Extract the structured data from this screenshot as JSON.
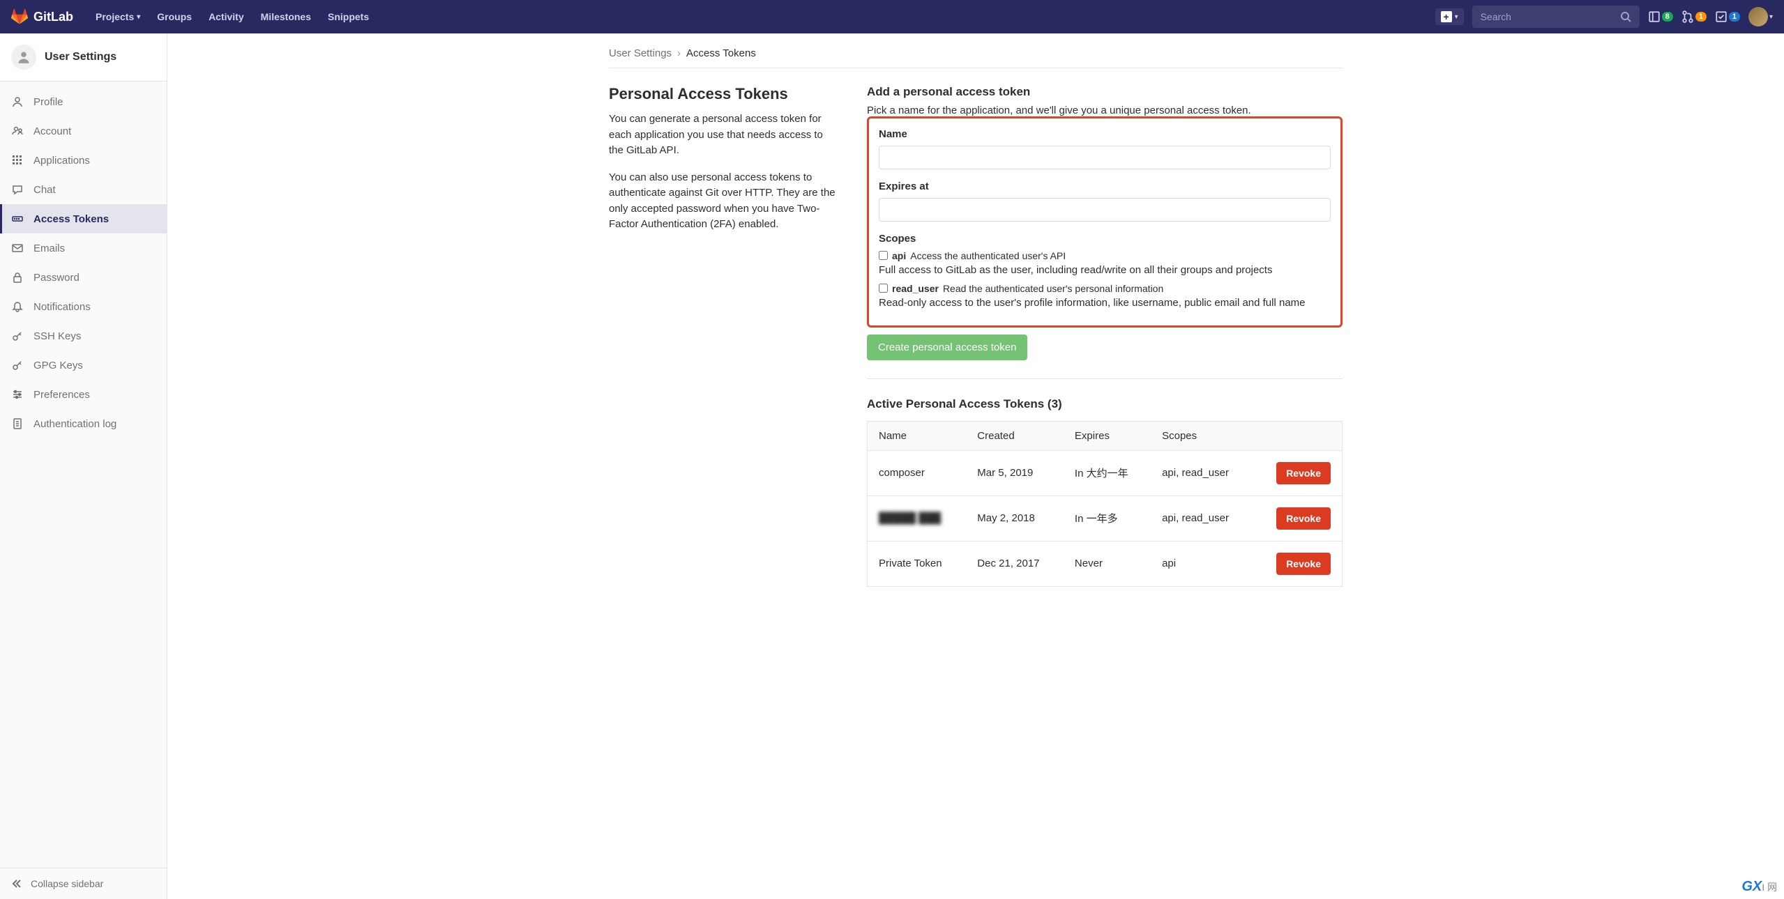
{
  "header": {
    "brand": "GitLab",
    "nav": [
      "Projects",
      "Groups",
      "Activity",
      "Milestones",
      "Snippets"
    ],
    "search_placeholder": "Search",
    "badges": {
      "issues": "8",
      "mrs": "1",
      "todos": "1"
    }
  },
  "sidebar": {
    "title": "User Settings",
    "items": [
      {
        "label": "Profile",
        "icon": "user-icon"
      },
      {
        "label": "Account",
        "icon": "account-icon"
      },
      {
        "label": "Applications",
        "icon": "apps-icon"
      },
      {
        "label": "Chat",
        "icon": "chat-icon"
      },
      {
        "label": "Access Tokens",
        "icon": "token-icon",
        "active": true
      },
      {
        "label": "Emails",
        "icon": "mail-icon"
      },
      {
        "label": "Password",
        "icon": "lock-icon"
      },
      {
        "label": "Notifications",
        "icon": "bell-icon"
      },
      {
        "label": "SSH Keys",
        "icon": "key-icon"
      },
      {
        "label": "GPG Keys",
        "icon": "key-icon"
      },
      {
        "label": "Preferences",
        "icon": "sliders-icon"
      },
      {
        "label": "Authentication log",
        "icon": "log-icon"
      }
    ],
    "collapse_label": "Collapse sidebar"
  },
  "breadcrumb": {
    "parent": "User Settings",
    "current": "Access Tokens"
  },
  "main": {
    "heading": "Personal Access Tokens",
    "desc1": "You can generate a personal access token for each application you use that needs access to the GitLab API.",
    "desc2": "You can also use personal access tokens to authenticate against Git over HTTP. They are the only accepted password when you have Two-Factor Authentication (2FA) enabled.",
    "form_title": "Add a personal access token",
    "form_subtitle": "Pick a name for the application, and we'll give you a unique personal access token.",
    "name_label": "Name",
    "expires_label": "Expires at",
    "scopes_label": "Scopes",
    "scopes": [
      {
        "key": "api",
        "short": "Access the authenticated user's API",
        "desc": "Full access to GitLab as the user, including read/write on all their groups and projects"
      },
      {
        "key": "read_user",
        "short": "Read the authenticated user's personal information",
        "desc": "Read-only access to the user's profile information, like username, public email and full name"
      }
    ],
    "create_btn": "Create personal access token",
    "active_title": "Active Personal Access Tokens (3)",
    "table_headers": [
      "Name",
      "Created",
      "Expires",
      "Scopes",
      ""
    ],
    "revoke_label": "Revoke",
    "tokens": [
      {
        "name": "composer",
        "created": "Mar 5, 2019",
        "expires": "In 大约一年",
        "scopes": "api, read_user"
      },
      {
        "name": "█████ ███",
        "created": "May 2, 2018",
        "expires": "In 一年多",
        "scopes": "api, read_user",
        "blurred": true
      },
      {
        "name": "Private Token",
        "created": "Dec 21, 2017",
        "expires": "Never",
        "scopes": "api"
      }
    ]
  },
  "watermark": {
    "brand": "GX",
    "suffix": "I 网"
  }
}
